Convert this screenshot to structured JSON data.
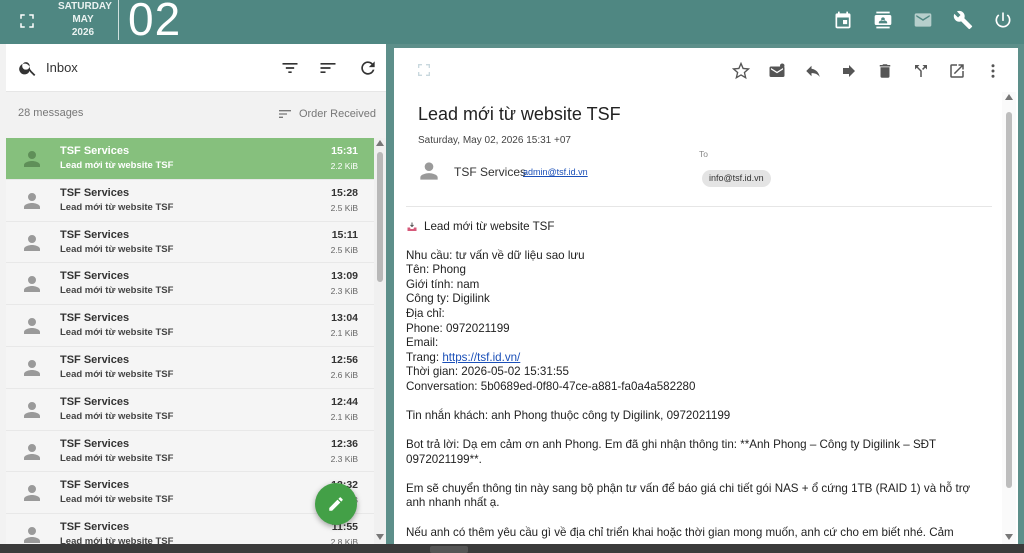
{
  "header": {
    "weekday": "SATURDAY",
    "month": "MAY",
    "year": "2026",
    "day": "02"
  },
  "list": {
    "search_label": "Inbox",
    "count": "28 messages",
    "order_label": "Order Received",
    "messages": [
      {
        "from": "TSF Services",
        "subject": "Lead mới từ website TSF",
        "time": "15:31",
        "size": "2.2 KiB",
        "selected": true
      },
      {
        "from": "TSF Services",
        "subject": "Lead mới từ website TSF",
        "time": "15:28",
        "size": "2.5 KiB"
      },
      {
        "from": "TSF Services",
        "subject": "Lead mới từ website TSF",
        "time": "15:11",
        "size": "2.5 KiB"
      },
      {
        "from": "TSF Services",
        "subject": "Lead mới từ website TSF",
        "time": "13:09",
        "size": "2.3 KiB"
      },
      {
        "from": "TSF Services",
        "subject": "Lead mới từ website TSF",
        "time": "13:04",
        "size": "2.1 KiB"
      },
      {
        "from": "TSF Services",
        "subject": "Lead mới từ website TSF",
        "time": "12:56",
        "size": "2.6 KiB"
      },
      {
        "from": "TSF Services",
        "subject": "Lead mới từ website TSF",
        "time": "12:44",
        "size": "2.1 KiB"
      },
      {
        "from": "TSF Services",
        "subject": "Lead mới từ website TSF",
        "time": "12:36",
        "size": "2.3 KiB"
      },
      {
        "from": "TSF Services",
        "subject": "Lead mới từ website TSF",
        "time": "12:32",
        "size": "2.1 KiB"
      },
      {
        "from": "TSF Services",
        "subject": "Lead mới từ website TSF",
        "time": "11:55",
        "size": "2.8 KiB"
      }
    ]
  },
  "message": {
    "subject": "Lead mới từ website TSF",
    "date": "Saturday, May 02, 2026 15:31 +07",
    "from_name": "TSF Services",
    "from_email": "admin@tsf.id.vn",
    "to_label": "To",
    "to": "info@tsf.id.vn",
    "body_title": "Lead mới từ website TSF",
    "fields": [
      "Nhu cầu: tư vấn về dữ liệu sao lưu",
      "Tên: Phong",
      "Giới tính: nam",
      "Công ty: Digilink",
      "Địa chỉ:",
      "Phone: 0972021199",
      "Email:"
    ],
    "page_label": "Trang: ",
    "page_link": "https://tsf.id.vn/",
    "time_line": "Thời gian: 2026-05-02 15:31:55",
    "conversation_line": "Conversation: 5b0689ed-0f80-47ce-a881-fa0a4a582280",
    "customer_msg": "Tin nhắn khách: anh Phong thuộc công ty Digilink, 0972021199",
    "bot_reply": "Bot trả lời: Dạ em cảm ơn anh Phong. Em đã ghi nhận thông tin: **Anh Phong – Công ty Digilink – SĐT 0972021199**.",
    "bot_reply2": "Em sẽ chuyển thông tin này sang bộ phận tư vấn để báo giá chi tiết gói NAS + ổ cứng 1TB (RAID 1) và hỗ trợ anh nhanh nhất ạ.",
    "bot_reply3": "Nếu anh có thêm yêu cầu gì về địa chỉ triển khai hoặc thời gian mong muốn, anh cứ cho em biết nhé. Cảm"
  },
  "colors": {
    "topbar": "#4f8782",
    "selected_row": "#86c07d",
    "fab": "#43a047",
    "link": "#1a4fb8"
  }
}
